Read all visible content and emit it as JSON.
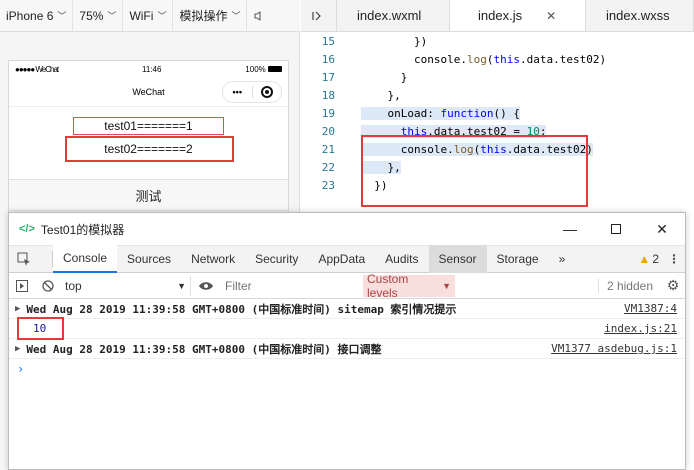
{
  "simulator": {
    "toolbar": {
      "device": "iPhone 6",
      "zoom": "75%",
      "network": "WiFi",
      "operation": "模拟操作"
    },
    "statusbar": {
      "carrier": "●●●●● WeChat",
      "time": "11:46",
      "battery": "100%"
    },
    "navbar": {
      "title": "WeChat",
      "menu": "•••"
    },
    "page": {
      "line1": "test01=======1",
      "line2": "test02=======2",
      "button": "测试"
    }
  },
  "editor": {
    "tabs": [
      "index.wxml",
      "index.js",
      "index.wxss"
    ],
    "active_tab": "index.js",
    "lines": [
      {
        "n": "15",
        "text": "        })"
      },
      {
        "n": "16",
        "text": "        console.log(this.data.test02)"
      },
      {
        "n": "17",
        "text": "      }"
      },
      {
        "n": "18",
        "text": "    },"
      },
      {
        "n": "19",
        "text": "    onLoad: function() {"
      },
      {
        "n": "20",
        "text": "      this.data.test02 = 10;"
      },
      {
        "n": "21",
        "text": "      console.log(this.data.test02)"
      },
      {
        "n": "22",
        "text": "    },"
      },
      {
        "n": "23",
        "text": "  })"
      }
    ]
  },
  "devtools": {
    "title": "Test01的模拟器",
    "tabs": [
      "Console",
      "Sources",
      "Network",
      "Security",
      "AppData",
      "Audits",
      "Sensor",
      "Storage"
    ],
    "active_tab": "Console",
    "warnings": "2",
    "context": "top",
    "filter_placeholder": "Filter",
    "levels": "Custom levels",
    "hidden": "2 hidden",
    "logs": [
      {
        "msg": "Wed Aug 28 2019 11:39:58 GMT+0800 (中国标准时间) sitemap 索引情况提示",
        "link": "VM1387:4"
      },
      {
        "value": "10",
        "link": "index.js:21"
      },
      {
        "msg": "Wed Aug 28 2019 11:39:58 GMT+0800 (中国标准时间) 接口调整",
        "link": "VM1377 asdebug.js:1"
      }
    ],
    "prompt": "›"
  },
  "colors": {
    "highlight": "#e23b3b",
    "accent": "#1a73e8"
  }
}
